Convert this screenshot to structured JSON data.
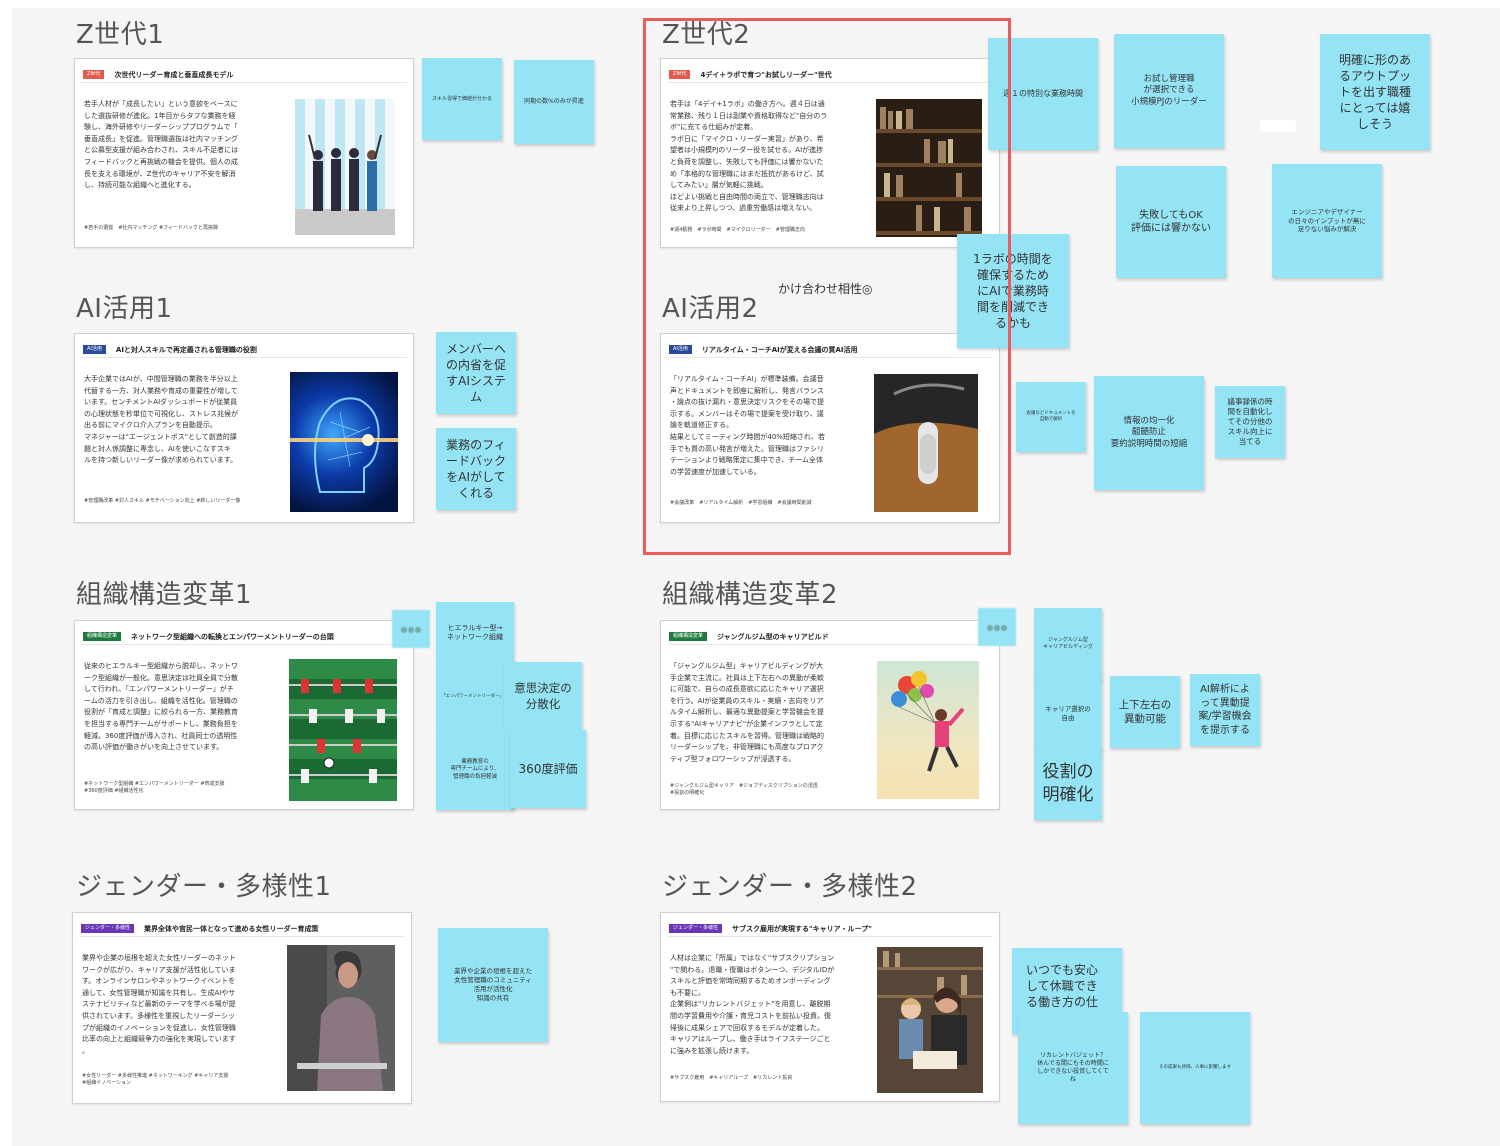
{
  "sections": {
    "z1": "Z世代1",
    "z2": "Z世代2",
    "ai1": "AI活用1",
    "ai2": "AI活用2",
    "org1": "組織構造変革1",
    "org2": "組織構造変革2",
    "gender1": "ジェンダー・多様性1",
    "gender2": "ジェンダー・多様性2"
  },
  "cards": {
    "z1": {
      "badge": "Z世代",
      "headline": "次世代リーダー育成と垂直成長モデル",
      "body": [
        "若手人材が「成長したい」という意欲をベースに",
        "した選抜研修が進化。1年目からタフな業務を経",
        "験し、海外研修やリーダーシッププログラムで「",
        "垂直成長」を促進。管理職選抜は社内マッチング",
        "と公募型支援が組み合わされ、スキル不足者には",
        "フィードバックと再挑戦の機会を提供。個人の成",
        "長を支える環境が、Z世代のキャリア不安を解消",
        "し、持続可能な組織へと進化する。"
      ],
      "tags": "#若手の選抜　#社内マッチング #フィードバックと再挑戦"
    },
    "z2": {
      "badge": "Z世代",
      "headline": "4デイ＋ラボで育つ\"お試しリーダー\"世代",
      "body": [
        "若手は「4デイ+1ラボ」の働き方へ。週４日は通",
        "常業務、残り１日は副業や資格取得など\"自分のラ",
        "ボ\"に充てる仕組みが定着。",
        "ラボ日に「マイクロ・リーダー実習」があり、希",
        "望者は小規模PJのリーダー役を試せる。AIが進捗",
        "と負荷を調整し、失敗しても評価には響かないた",
        "め「本格的な管理職にはまだ抵抗があるけど、試",
        "してみたい」層が気軽に挑戦。",
        "ほどよい挑戦と自由時間の両立で、管理職志向は",
        "従来より上昇しつつ、過重労働感は増えない。"
      ],
      "tags": "#週4勤務　#ラボ時間　#マイクロリーダー　#管理職志向"
    },
    "ai1": {
      "badge": "AI活用",
      "headline": "AIと対人スキルで再定義される管理職の役割",
      "body": [
        "大手企業ではAIが、中間管理職の業務を半分以上",
        "代替する一方、対人業務や育成の重要性が増して",
        "います。センチメントAIダッシュボードが従業員",
        "の心理状態を秒単位で可視化し、ストレス兆候が",
        "出る前にマイクロ介入プランを自動提示。",
        "マネジャーは\"エージェントボス\"として創造的課",
        "題と対人係調整に専念し、AIを使いこなすスキ",
        "ルを持つ新しいリーダー像が求められています。"
      ],
      "tags": "#管理職改革 #対人スキル #モチベーション向上 #新しいリーダー像"
    },
    "ai2": {
      "badge": "AI活用",
      "headline": "リアルタイム・コーチAIが変える会議の質AI活用",
      "body": [
        "「リアルタイム・コーチAI」が標準装備。会議音",
        "声とドキュメントを即座に解析し、発言バランス",
        "・論点の抜け漏れ・意思決定リスクをその場で提",
        "示する。メンバーはその場で提案を受け取り、議",
        "論を軌道修正する。",
        "結果としてミーティング時間が40%短縮され、若",
        "手でも質の高い発言が増えた。管理職はファシリ",
        "テーションより戦略策定に集中でき、チーム全体",
        "の学習速度が加速している。"
      ],
      "tags": "#会議改革　#リアルタイム解析　#学習組織　#会議時間削減"
    },
    "org1": {
      "badge": "組織構造変革",
      "headline": "ネットワーク型組織への転換とエンパワーメントリーダーの台頭",
      "body": [
        "従来のヒエラルキー型組織から脱却し、ネットワ",
        "ーク型組織が一般化。意思決定は社員全員で分散",
        "して行われ、「エンパワーメントリーダー」がチ",
        "ームの活力を引き出し、組織を活性化。管理職の",
        "役割が「育成と調整」に絞られる一方、業務教育",
        "を担当する専門チームがサポートし、業務負担を",
        "軽減。360度評価が導入され、社員同士の透明性",
        "の高い評価が働きがいを向上させています。"
      ],
      "tags": "#ネットワーク型組織 #エンパワーメントリーダー #育成支援\n#360度評価 #組織活性化"
    },
    "org2": {
      "badge": "組織構造変革",
      "headline": "ジャングルジム型のキャリアビルド",
      "body": [
        "「ジャングルジム型」キャリアビルディングが大",
        "手企業で主流に。社員は上下左右への異動が柔軟",
        "に可能で、自らの成長意欲に応じたキャリア選択",
        "を行う。AIが従業員のスキル・実績・志向をリア",
        "ルタイム解析し、最適な異動提案と学習機会を提",
        "示する\"AIキャリアナビ\"が企業インフラとして定",
        "着。目標に応じたスキルを習得。管理職は戦略的",
        "リーダーシップを、非管理職にも高度なプロアク",
        "ティブ型フォロワーシップが浸透する。"
      ],
      "tags": "#ジャングルジム型キャリア　#ジョブディスクリプションの浸透\n#役割の明確化"
    },
    "gender1": {
      "badge": "ジェンダー・多様性",
      "headline": "業界全体や官民一体となって進める女性リーダー育成策",
      "body": [
        "業界や企業の垣根を超えた女性リーダーのネット",
        "ワークが広がり、キャリア支援が活性化していま",
        "す。オンラインサロンやネットワークイベントを",
        "通して、女性管理職が知識を共有し、生成AIやサ",
        "ステナビリティなど最新のテーマを学べる場が提",
        "供されています。多様性を重視したリーダーシッ",
        "プが組織のイノベーションを促進し、女性管理職",
        "比率の向上と組織競争力の強化を実現しています",
        "。"
      ],
      "tags": "#女性リーダー #多様性推進 #ネットワーキング #キャリア支援\n#組織イノベーション"
    },
    "gender2": {
      "badge": "ジェンダー・多様性",
      "headline": "サブスク雇用が実現する\"キャリア・ループ\"",
      "body": [
        "人材は企業に「所属」ではなく\"サブスクリプション",
        "\"で関わる。退職・復職はボタン一つ、デジタルIDが",
        "スキルと評価を常時同期するためオンボーディング",
        "も不要に。",
        "企業側は\"リカレントバジェット\"を用意し、離脱期",
        "間の学習費用や介護・育児コストを前払い投資。復",
        "帰後に成果シェアで回収するモデルが定着した。",
        "キャリアはループし、働き手はライフステージごと",
        "に強みを拡張し続けます。"
      ],
      "tags": "#サブスク雇用　#キャリアループ　#リカレント投資"
    }
  },
  "stickies": {
    "z1_a": "スキル習得で価値が分かる",
    "z1_b": "同期の数%のみが昇進",
    "z2_a": "週１の特別な業務時間",
    "z2_b": "お試し管理職\nが選択できる\n小規模PJのリーダー",
    "z2_c": "明確に形のあ\nるアウトプッ\nトを出す職種\nにとっては嬉\nしそう",
    "z2_d": "失敗してもOK\n評価には響かない",
    "z2_e": "エンジニアやデザイナー\nの日々のインプットが無に\n足りない悩みが解決",
    "z2_f": "1ラボの時間を\n確保するため\nにAIで業務時\n間を削減でき\nるかも",
    "ai1_a": "メンバーへ\nの内省を促\nすAIシステ\nム",
    "ai1_b": "業務のフィ\nードバック\nをAIがして\nくれる",
    "ai2_a": "会議などドキュメントを\n自動で解析",
    "ai2_b": "情報の均一化\n齟齬防止\n要約説明時間の短縮",
    "ai2_c": "議事録係の時\n間を自動化し\nてその分他の\nスキル向上に\n当てる",
    "org1_a": "ヒエラルキー型→\nネットワーク組織",
    "org1_b": "「エンパワーメントリーダー」??",
    "org1_c": "意思決定の\n分散化",
    "org1_d": "業務教育の\n専門チームにより、\n管理職の負担軽減",
    "org1_e": "360度評価",
    "org2_a": "ジャングルジム型\nキャリアビルディング",
    "org2_b": "キャリア選択の\n自由",
    "org2_c": "上下左右の\n異動可能",
    "org2_d": "AI解析によ\nって異動提\n案/学習機会\nを提示する",
    "org2_e": "役割の\n明確化",
    "gender1_a": "業界や企業の垣根を超えた\n女性管理職のコミュニティ\n活用が活性化\n知識の共有",
    "gender2_a": "いつでも安心\nして休職でき\nる働き方の仕",
    "gender2_b": "リカレントバジェット？\n休んでる間にもその時間に\nしかできない投資してくて\nね",
    "gender2_c": "その成果も評価、人事に影響します"
  },
  "annotation": "かけ合わせ相性◎",
  "colors": {
    "sticky": "#95e4f6",
    "selection": "#ea5d5f",
    "badge_z": "#e35a4f",
    "badge_ai": "#2a4a9a",
    "badge_org": "#1e7a3e",
    "badge_gender": "#6a35b6"
  }
}
